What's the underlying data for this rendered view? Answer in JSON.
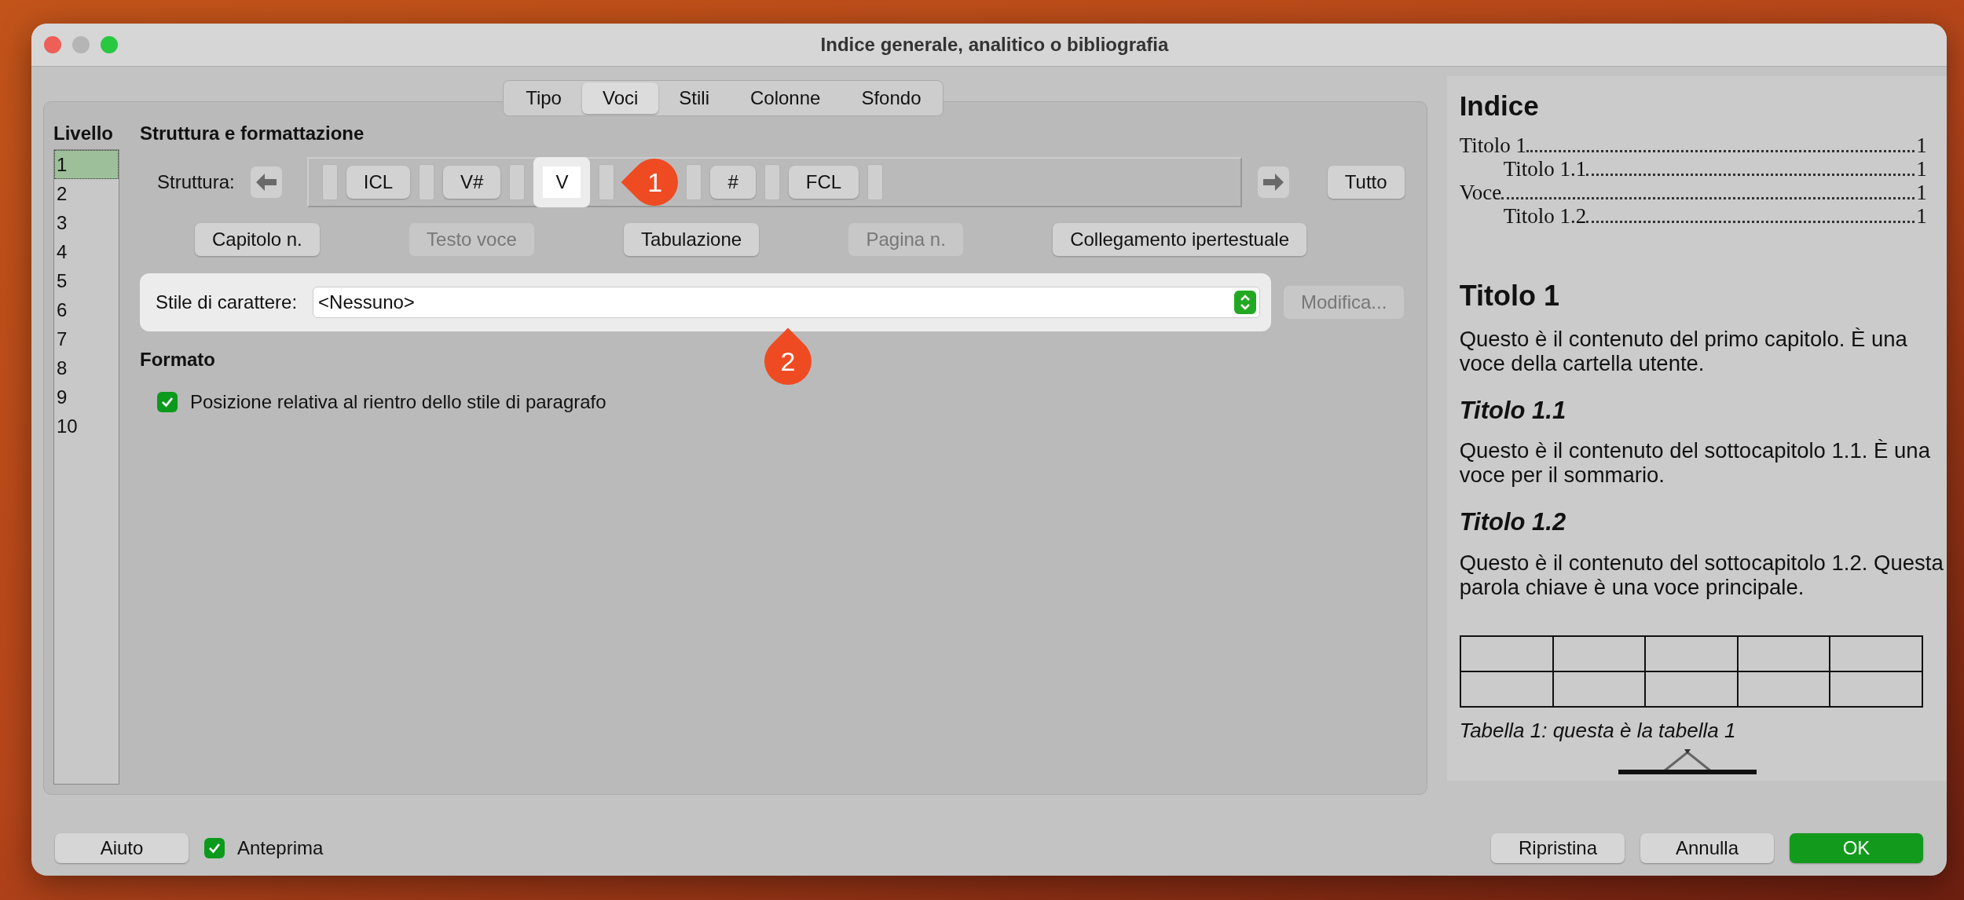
{
  "window": {
    "title": "Indice generale, analitico o bibliografia"
  },
  "tabs": [
    {
      "label": "Tipo",
      "selected": false
    },
    {
      "label": "Voci",
      "selected": true
    },
    {
      "label": "Stili",
      "selected": false
    },
    {
      "label": "Colonne",
      "selected": false
    },
    {
      "label": "Sfondo",
      "selected": false
    }
  ],
  "levels": {
    "heading": "Livello",
    "items": [
      {
        "label": "1",
        "selected": true
      },
      {
        "label": "2",
        "selected": false
      },
      {
        "label": "3",
        "selected": false
      },
      {
        "label": "4",
        "selected": false
      },
      {
        "label": "5",
        "selected": false
      },
      {
        "label": "6",
        "selected": false
      },
      {
        "label": "7",
        "selected": false
      },
      {
        "label": "8",
        "selected": false
      },
      {
        "label": "9",
        "selected": false
      },
      {
        "label": "10",
        "selected": false
      }
    ]
  },
  "structure": {
    "heading": "Struttura e formattazione",
    "label": "Struttura:",
    "all_button": "Tutto",
    "elements": [
      {
        "kind": "slot",
        "selected": false
      },
      {
        "kind": "token",
        "label": "ICL",
        "selected": false
      },
      {
        "kind": "slot",
        "selected": false
      },
      {
        "kind": "token",
        "label": "V#",
        "selected": false
      },
      {
        "kind": "slot",
        "selected": false
      },
      {
        "kind": "token",
        "label": "V",
        "selected": true,
        "callout": "1"
      },
      {
        "kind": "slot",
        "selected": false
      },
      {
        "kind": "slot",
        "selected": false
      },
      {
        "kind": "token",
        "label": "#",
        "selected": false
      },
      {
        "kind": "slot",
        "selected": false
      },
      {
        "kind": "token",
        "label": "FCL",
        "selected": false
      },
      {
        "kind": "slot",
        "selected": false
      }
    ],
    "insert_buttons": [
      {
        "label": "Capitolo n.",
        "disabled": false
      },
      {
        "label": "Testo voce",
        "disabled": true
      },
      {
        "label": "Tabulazione",
        "disabled": false
      },
      {
        "label": "Pagina n.",
        "disabled": true
      },
      {
        "label": "Collegamento ipertestuale",
        "disabled": false
      }
    ]
  },
  "character_style": {
    "label": "Stile di carattere:",
    "value": "<Nessuno>",
    "callout": "2",
    "edit_button": {
      "label": "Modifica...",
      "disabled": true
    }
  },
  "format": {
    "heading": "Formato",
    "option": {
      "label": "Posizione relativa al rientro dello stile di paragrafo",
      "checked": true
    }
  },
  "preview": {
    "title": "Indice",
    "toc": [
      {
        "text": "Titolo 1",
        "page": "1",
        "children": [
          {
            "text": "Titolo 1.1",
            "page": "1"
          }
        ]
      },
      {
        "text": "Voce",
        "page": "1",
        "children": [
          {
            "text": "Titolo 1.2",
            "page": "1"
          }
        ]
      }
    ],
    "sections": [
      {
        "kind": "h1",
        "heading": "Titolo 1",
        "text": "Questo è il contenuto del primo capitolo. È una voce della cartella utente."
      },
      {
        "kind": "h2",
        "heading": "Titolo 1.1",
        "text": "Questo è il contenuto del sottocapitolo 1.1. È una voce per il sommario."
      },
      {
        "kind": "h2",
        "heading": "Titolo 1.2",
        "text": "Questo è il contenuto del sottocapitolo 1.2. Questa parola chiave è una voce principale."
      }
    ],
    "table_caption": "Tabella 1: questa è la tabella 1"
  },
  "footer": {
    "help_button": "Aiuto",
    "preview_option": {
      "label": "Anteprima",
      "checked": true
    },
    "buttons": [
      {
        "label": "Ripristina",
        "kind": "normal"
      },
      {
        "label": "Annulla",
        "kind": "normal"
      },
      {
        "label": "OK",
        "kind": "default"
      }
    ]
  }
}
